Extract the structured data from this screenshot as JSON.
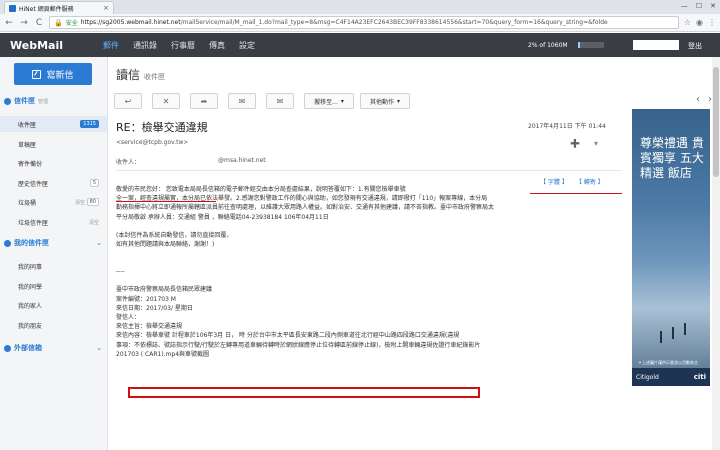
{
  "browser": {
    "tab_title": "HiNet 網頁郵件服務",
    "tab_close": "×",
    "window_controls": [
      "—",
      "☐",
      "✕"
    ],
    "back": "←",
    "forward": "→",
    "reload": "C",
    "secure_label": "安全",
    "url_host": "https://sg2005.webmail.hinet.net",
    "url_path": "/mailService/mail/M_mail_1.do?mail_type=8&msg=C4F14A23EFC2643BEC39FF8338614556&start=70&query_form=16&query_string=&folde"
  },
  "header": {
    "logo": "WebMail",
    "nav": [
      "郵件",
      "通訊錄",
      "行事曆",
      "傳真",
      "設定"
    ],
    "quota_text": "2% of 1060M",
    "quota_percent": 2,
    "logout": "登出"
  },
  "sidebar": {
    "compose_label": "寫新信",
    "inbox_section": {
      "title": "信件匣",
      "manage": "管理"
    },
    "folders": [
      {
        "label": "收件匣",
        "count": "1315"
      },
      {
        "label": "草稿匣",
        "count": ""
      },
      {
        "label": "寄件備份",
        "count": ""
      },
      {
        "label": "歷史信件匣",
        "count": "5"
      },
      {
        "label": "垃圾桶",
        "count": "80",
        "clear": "清空"
      },
      {
        "label": "垃圾信件匣",
        "count": "",
        "clear": "清空"
      }
    ],
    "my_section": {
      "title": "我的信件匣"
    },
    "my_folders": [
      "我的同事",
      "我的同學",
      "我的家人",
      "我的朋友"
    ],
    "external_section": {
      "title": "外部信箱"
    }
  },
  "main": {
    "heading": "讀信",
    "heading_folder": "收件匣",
    "toolbar": {
      "back": "↩",
      "delete": "✕",
      "forward": "➦",
      "reply": "✉",
      "more": "✉",
      "move_to": "搬移至...",
      "other_actions": "其他動作",
      "prev": "‹",
      "next": "›"
    },
    "subject": "RE：檢舉交通違規",
    "date": "2017年4月11日 下午 01:44",
    "sender": "<service@tcpb.gov.tw>",
    "recipient_label": "收件人：",
    "recipient_domain": "@msa.hinet.net",
    "body_links": [
      "【 字體 】",
      "【 轉寄 】"
    ],
    "body_lines": [
      "敬愛的市民您好： 您致電本局局長信箱的電子郵件經交由本分局查處結果，說明答覆如下：1.有關您檢舉車號",
      "全一案，經查違規屬實，本分局已依法舉發。2.感謝您對警政工作的關心與協助，如您發現有交通違規，請即撥打「110」報案專線，本分局",
      "勤務指揮中心將立即通報所屬轄區派員前往查明處理，以維護大眾用路人權益。如對治安、交通有其他建議，請不吝指教。臺中市政府警察局太",
      "平分局敬啟 承辦人員：交通組 警員          ，聯絡電話04-23938184 106年04月11日",
      "",
      "(本封信件為系統自動發信，請勿直接回覆，",
      "如有其他問題請與本局聯絡，謝謝！)",
      "",
      "",
      "----",
      "",
      "臺中市政府警察局局長信箱民眾建議",
      "案件編號：201703           M",
      "來信日期：2017/03/    星期日",
      "發信人：",
      "來信主旨：檢舉交通違規",
      "來信內容：檢舉車號       計程車於106年3月  日，   時    分於台中市太平區長安東路二段內側車道往北行經中山路四段路口交通違規(違規",
      "事項：不依標誌、號誌指示行駛/行駛於左轉專用道車輛待轉時於網狀線應停止位待轉區前線停止線)，檢附上開車輛違規佐證行車紀錄影片",
      "201703             (       CAR1).mp4與車號截圖"
    ]
  },
  "ad": {
    "title": "尊榮禮遇 貴賓獨享 五大精選 飯店",
    "caption": "＊上述圖片僅供示意並以活動為主",
    "brand_left": "Citigold",
    "brand_right": "citi"
  }
}
